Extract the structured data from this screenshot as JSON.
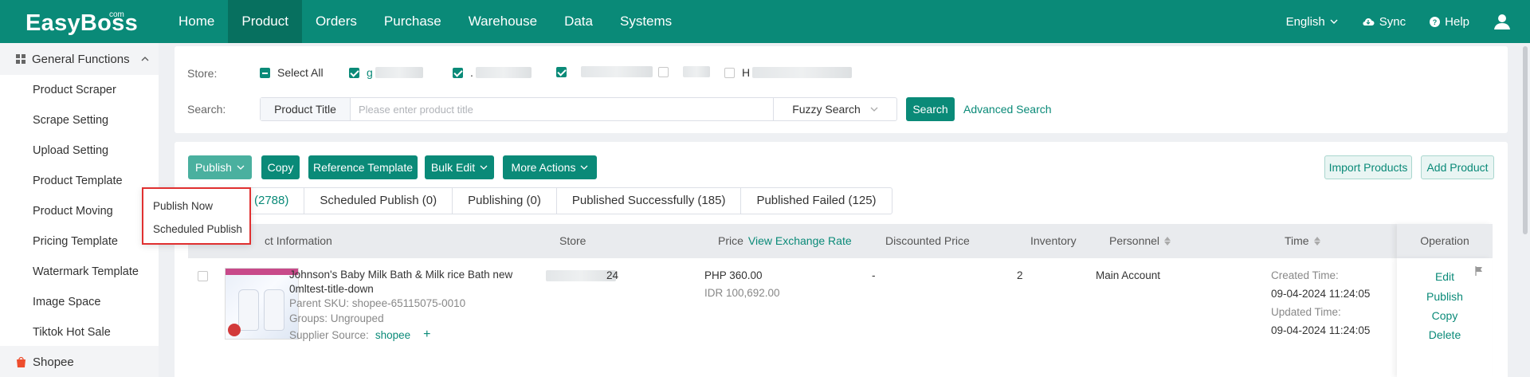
{
  "app": {
    "logo": "EasyBoss",
    "logo_sup": "com"
  },
  "nav": [
    "Home",
    "Product",
    "Orders",
    "Purchase",
    "Warehouse",
    "Data",
    "Systems"
  ],
  "top_right": {
    "language": "English",
    "sync": "Sync",
    "help": "Help"
  },
  "sidebar": {
    "group": "General Functions",
    "items": [
      "Product Scraper",
      "Scrape Setting",
      "Upload Setting",
      "Product Template",
      "Product Moving",
      "Pricing Template",
      "Watermark Template",
      "Image Space",
      "Tiktok Hot Sale"
    ],
    "bottom_group": "Shopee"
  },
  "filter": {
    "store_label": "Store:",
    "select_all": "Select All",
    "stores": [
      "g",
      ".",
      "",
      "",
      "H"
    ],
    "search_label": "Search:",
    "search_field": "Product Title",
    "search_placeholder": "Please enter product title",
    "search_mode": "Fuzzy Search",
    "search_button": "Search",
    "advanced_search": "Advanced Search"
  },
  "toolbar": {
    "publish": "Publish",
    "copy": "Copy",
    "reference_template": "Reference Template",
    "bulk_edit": "Bulk Edit",
    "more_actions": "More Actions",
    "import_products": "Import Products",
    "add_product": "Add Product"
  },
  "dropdown": {
    "items": [
      "Publish Now",
      "Scheduled Publish"
    ]
  },
  "tabs": [
    {
      "label": "(2788)"
    },
    {
      "label": "Scheduled Publish (0)"
    },
    {
      "label": "Publishing (0)"
    },
    {
      "label": "Published Successfully (185)"
    },
    {
      "label": "Published Failed (125)"
    }
  ],
  "table": {
    "headers": {
      "product_info": "ct Information",
      "store": "Store",
      "price": "Price",
      "price_link": "View Exchange Rate",
      "discounted": "Discounted Price",
      "inventory": "Inventory",
      "personnel": "Personnel",
      "time": "Time",
      "operation": "Operation"
    },
    "row": {
      "title_line1": "Johnson's Baby Milk Bath & Milk rice Bath new",
      "title_line2": "0mltest-title-down",
      "parent_sku": "Parent SKU:  shopee-65115075-0010",
      "groups": "Groups:   Ungrouped",
      "supplier_label": "Supplier Source:",
      "supplier_value": "shopee",
      "store": "24",
      "price_php": "PHP 360.00",
      "price_idr": "IDR 100,692.00",
      "discounted": "-",
      "inventory": "2",
      "personnel": "Main Account",
      "created_label": "Created Time:",
      "created_value": "09-04-2024 11:24:05",
      "updated_label": "Updated Time:",
      "updated_value": "09-04-2024 11:24:05",
      "ops": [
        "Edit",
        "Publish",
        "Copy",
        "Delete"
      ]
    }
  }
}
